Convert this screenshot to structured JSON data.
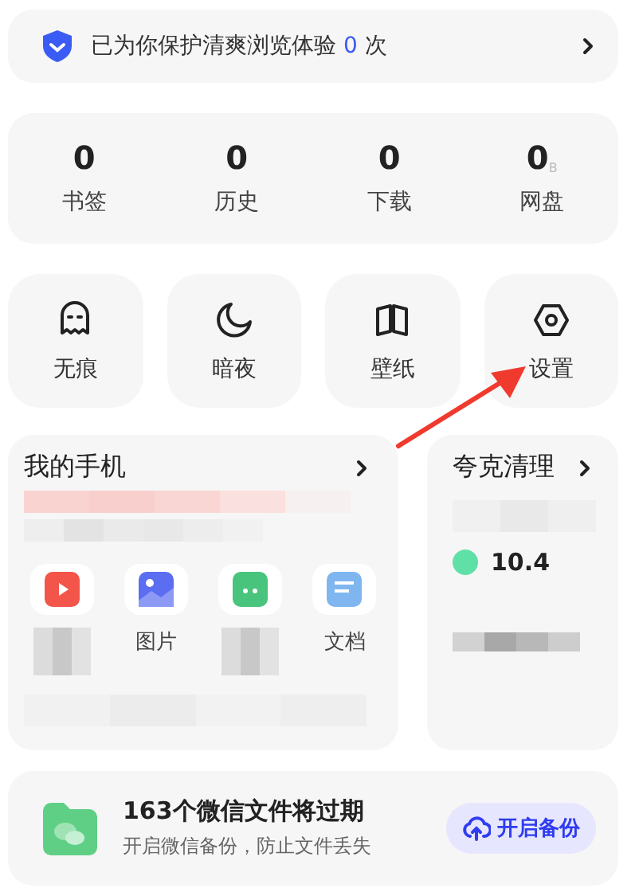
{
  "protection_banner": {
    "prefix": "已为你保护清爽浏览体验",
    "count": "0",
    "suffix": "次"
  },
  "stats": [
    {
      "value": "0",
      "label": "书签"
    },
    {
      "value": "0",
      "label": "历史"
    },
    {
      "value": "0",
      "label": "下载"
    },
    {
      "value": "0",
      "unit": "B",
      "label": "网盘"
    }
  ],
  "tools": [
    {
      "kind": "ghost",
      "label": "无痕"
    },
    {
      "kind": "moon",
      "label": "暗夜"
    },
    {
      "kind": "book",
      "label": "壁纸"
    },
    {
      "kind": "hexagon",
      "label": "设置"
    }
  ],
  "my_phone": {
    "title": "我的手机",
    "apps": [
      {
        "kind": "video"
      },
      {
        "kind": "image",
        "label": "图片"
      },
      {
        "kind": "package"
      },
      {
        "kind": "document",
        "label": "文档"
      }
    ]
  },
  "cleanup": {
    "title": "夸克清理",
    "reading": "10.4"
  },
  "wechat_backup": {
    "title": "163个微信文件将过期",
    "subtitle": "开启微信备份，防止文件丢失",
    "button": "开启备份"
  },
  "annotation_arrow": true
}
